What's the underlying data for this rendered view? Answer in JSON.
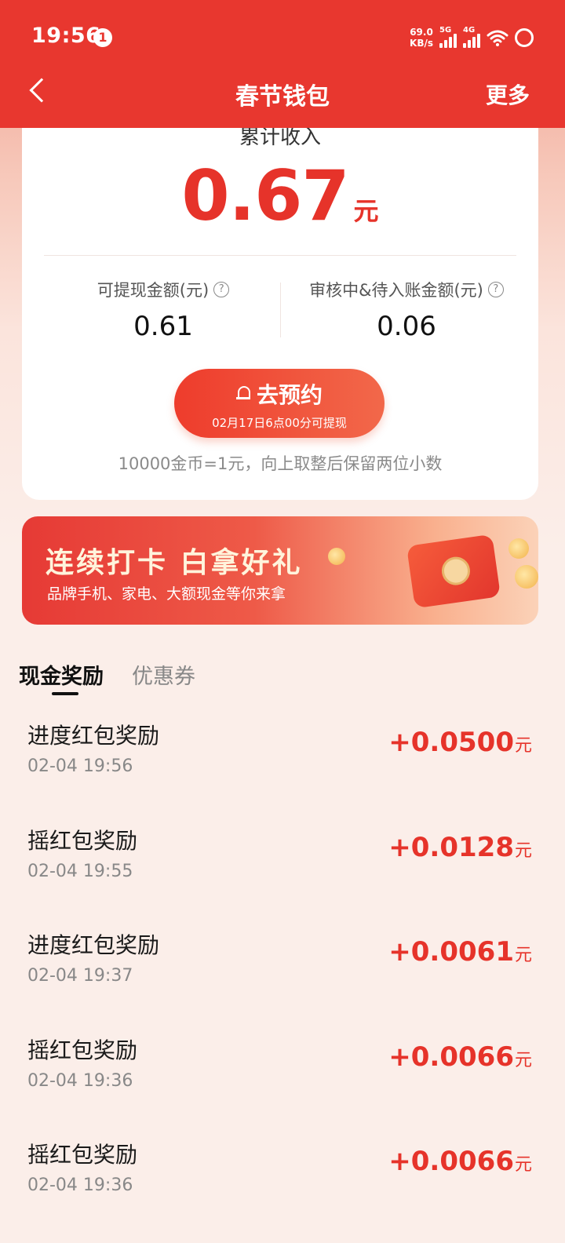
{
  "status_bar": {
    "time": "19:56",
    "notification_count": "1",
    "net_speed_value": "69.0",
    "net_speed_unit": "KB/s",
    "signal1_label": "5G",
    "signal2_label": "4G"
  },
  "header": {
    "title": "春节钱包",
    "more_label": "更多"
  },
  "wallet": {
    "cumulative_label": "累计收入",
    "cumulative_amount": "0.67",
    "cumulative_unit": "元",
    "withdrawable_label": "可提现金额(元)",
    "withdrawable_value": "0.61",
    "pending_label": "审核中&待入账金额(元)",
    "pending_value": "0.06",
    "help_icon_glyph": "?",
    "reserve_button_label": "去预约",
    "reserve_button_sub": "02月17日6点00分可提现",
    "coin_note": "10000金币=1元，向上取整后保留两位小数"
  },
  "banner": {
    "title": "连续打卡 白拿好礼",
    "subtitle": "品牌手机、家电、大额现金等你来拿"
  },
  "tabs": [
    {
      "label": "现金奖励",
      "active": true
    },
    {
      "label": "优惠券",
      "active": false
    }
  ],
  "records": [
    {
      "title": "进度红包奖励",
      "time": "02-04 19:56",
      "amount": "+0.0500",
      "unit": "元"
    },
    {
      "title": "摇红包奖励",
      "time": "02-04 19:55",
      "amount": "+0.0128",
      "unit": "元"
    },
    {
      "title": "进度红包奖励",
      "time": "02-04 19:37",
      "amount": "+0.0061",
      "unit": "元"
    },
    {
      "title": "摇红包奖励",
      "time": "02-04 19:36",
      "amount": "+0.0066",
      "unit": "元"
    },
    {
      "title": "摇红包奖励",
      "time": "02-04 19:36",
      "amount": "+0.0066",
      "unit": "元"
    }
  ],
  "colors": {
    "brand_red": "#e8372f",
    "amount_red": "#e6332a",
    "page_bg": "#fbeee9"
  }
}
